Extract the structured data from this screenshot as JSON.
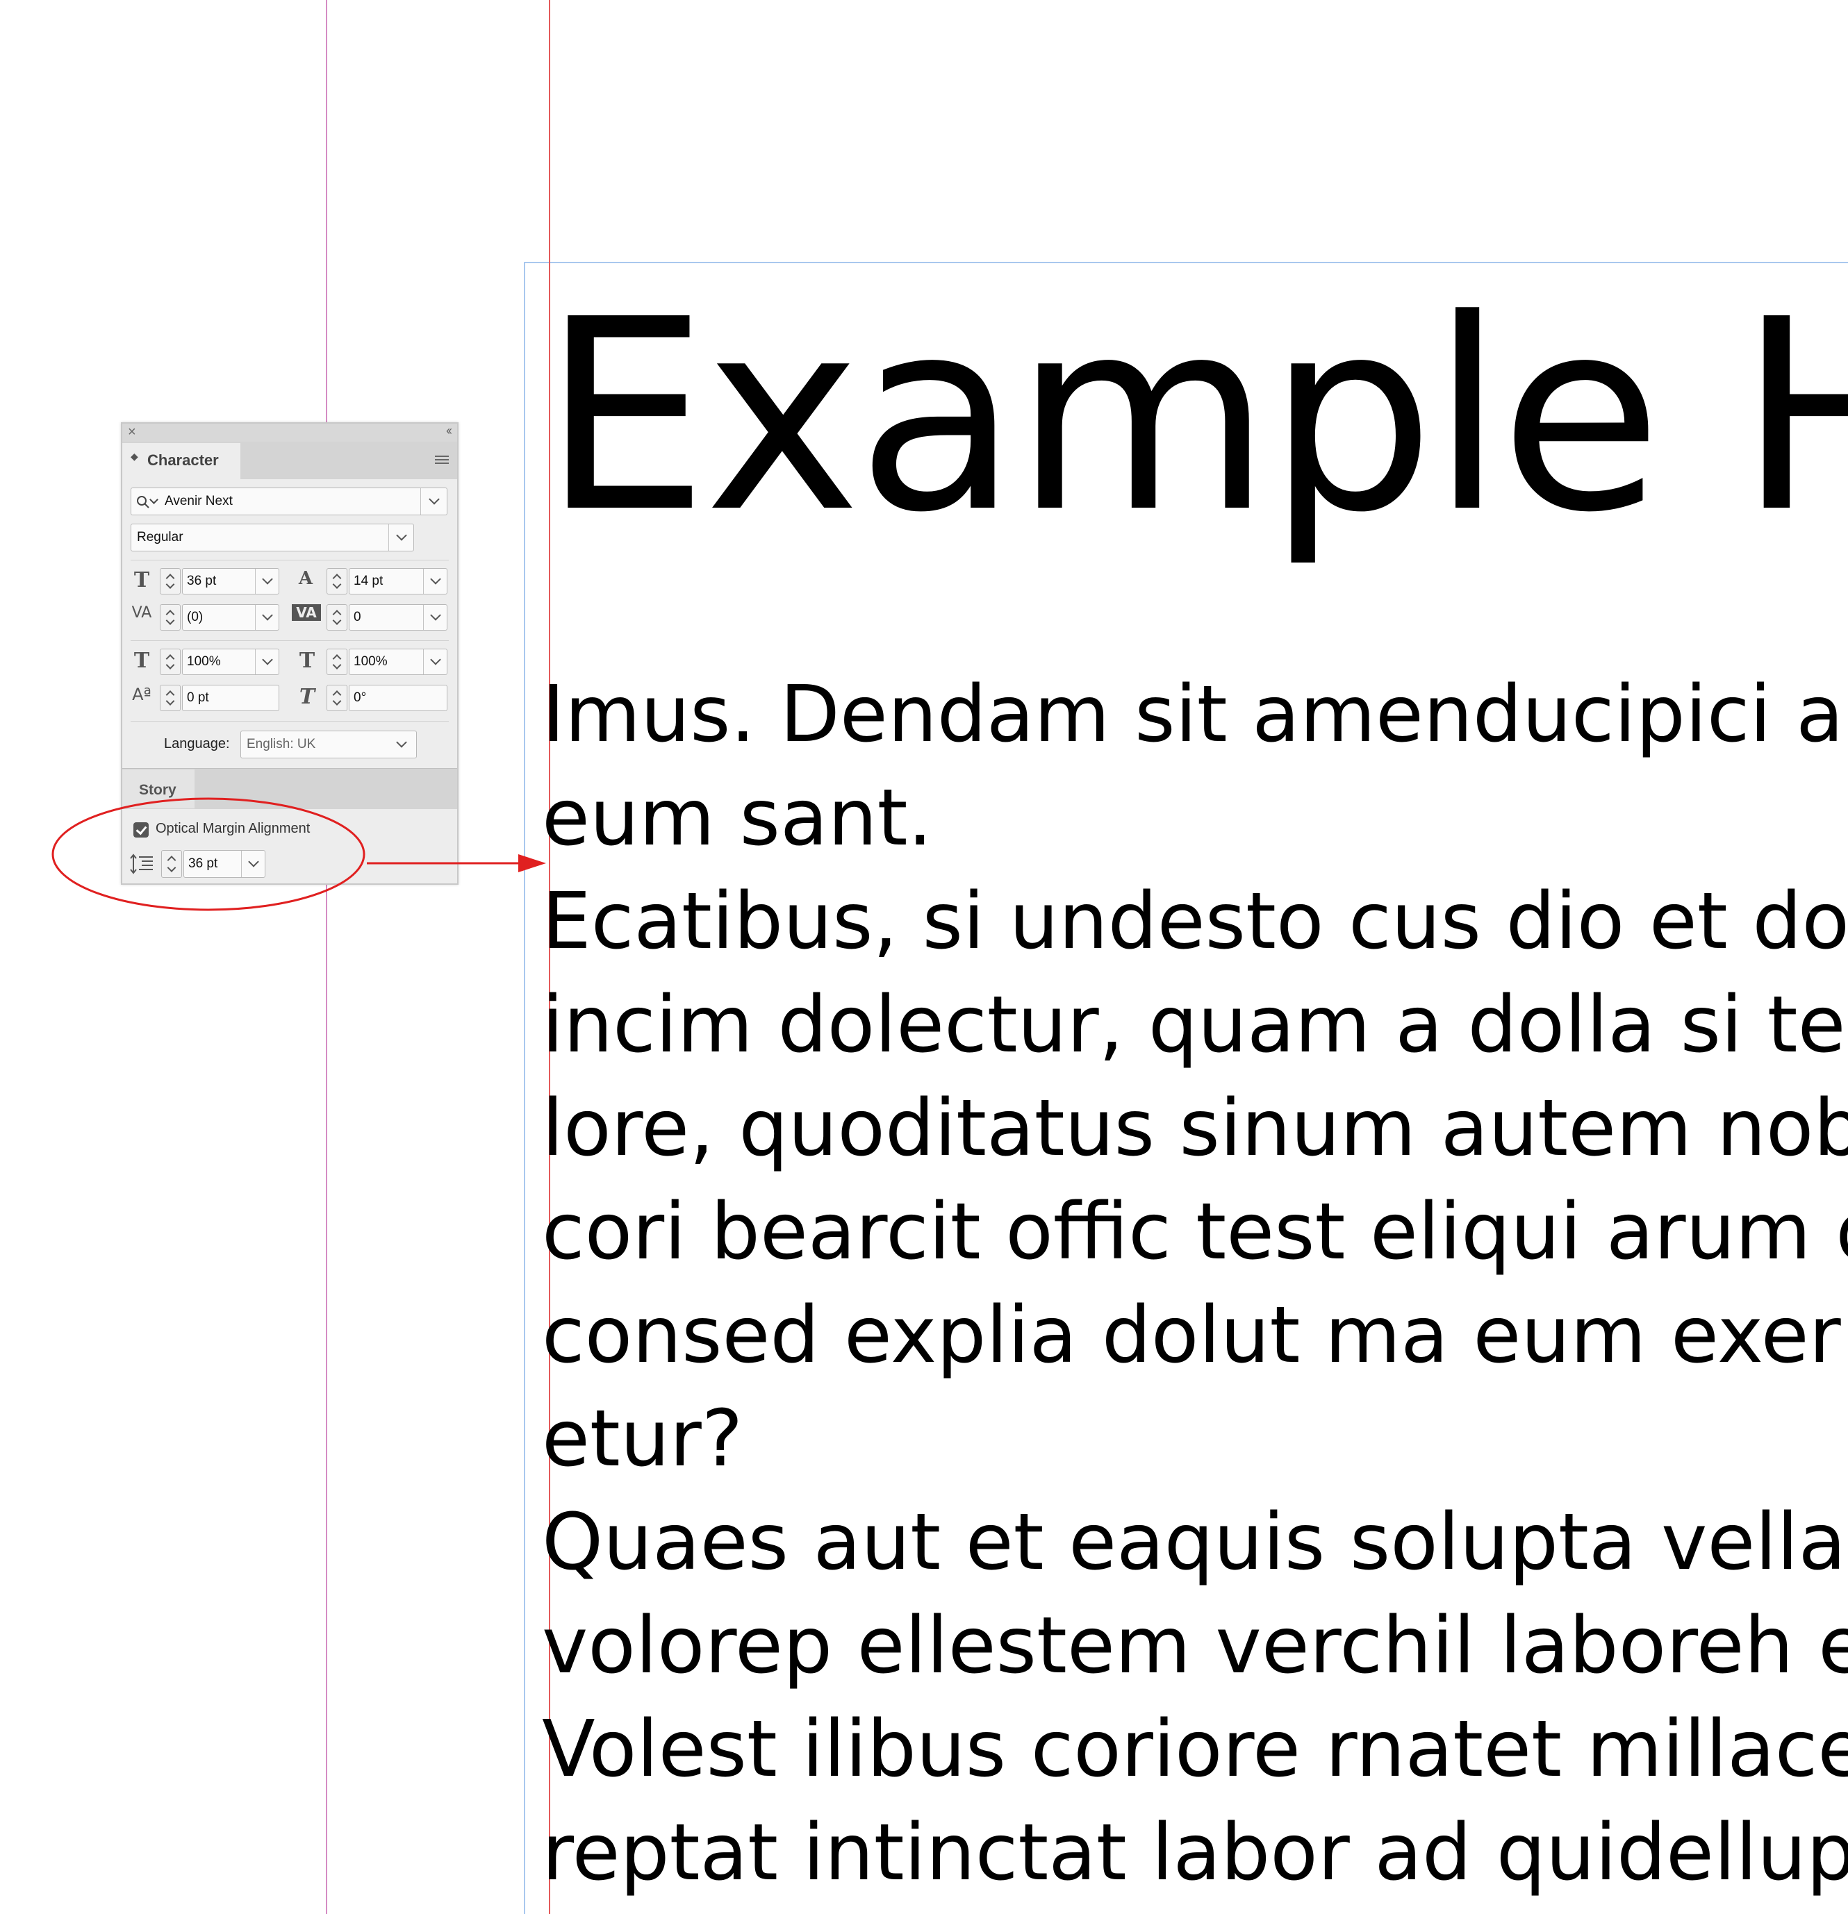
{
  "document": {
    "heading": "Example H",
    "body_lines": [
      "Imus. Dendam sit amenducipici aut",
      "eum sant.",
      "Ecatibus, si undesto cus dio et dolu",
      "incim dolectur, quam a dolla si tes a",
      "lore, quoditatus sinum autem nobita",
      "cori bearcit offic test eliqui arum do",
      "consed explia dolut ma eum exerib",
      "etur?",
      "Quaes aut et eaquis solupta vellam,",
      "volorep ellestem verchil laboreh en",
      "Volest ilibus coriore rnatet millacest",
      "reptat intinctat labor ad quidellupie"
    ]
  },
  "character_panel": {
    "close_glyph": "×",
    "collapse_glyph": "‹‹",
    "tab_label": "Character",
    "font_family": "Avenir Next",
    "font_style": "Regular",
    "font_size": "36 pt",
    "leading": "14 pt",
    "kerning": "(0)",
    "tracking": "0",
    "vertical_scale": "100%",
    "horizontal_scale": "100%",
    "baseline_shift": "0 pt",
    "skew": "0°",
    "language_label": "Language:",
    "language_value": "English: UK"
  },
  "story_panel": {
    "tab_label": "Story",
    "optical_margin_label": "Optical Margin Alignment",
    "optical_margin_checked": true,
    "optical_margin_size": "36 pt"
  },
  "colors": {
    "annotation_red": "#e02020",
    "margin_guide": "#e35a5a",
    "page_guide": "#d58cc4",
    "frame_edge": "#a9c8ee"
  }
}
